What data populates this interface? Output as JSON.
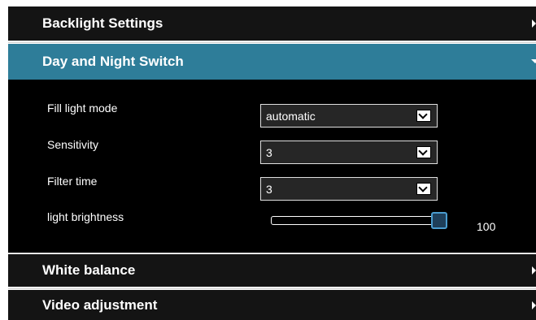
{
  "sections": {
    "backlight": {
      "title": "Backlight Settings",
      "state": "collapsed"
    },
    "day_night": {
      "title": "Day and Night Switch",
      "state": "expanded"
    },
    "white_balance": {
      "title": "White balance",
      "state": "collapsed"
    },
    "video_adjust": {
      "title": "Video adjustment",
      "state": "collapsed"
    }
  },
  "day_night_panel": {
    "fill_light_mode": {
      "label": "Fill light mode",
      "value": "automatic"
    },
    "sensitivity": {
      "label": "Sensitivity",
      "value": "3"
    },
    "filter_time": {
      "label": "Filter time",
      "value": "3"
    },
    "light_brightness": {
      "label": "light brightness",
      "value": "100",
      "fraction": 1.0
    }
  },
  "colors": {
    "expanded_header": "#2e7d99",
    "collapsed_header": "#141414",
    "panel_background": "#000000",
    "slider_thumb_border": "#4a9ccf"
  },
  "icons": {
    "collapsed_arrow": "caret-right-icon",
    "expanded_arrow": "caret-down-icon",
    "dropdown": "dropdown-arrow-icon"
  }
}
